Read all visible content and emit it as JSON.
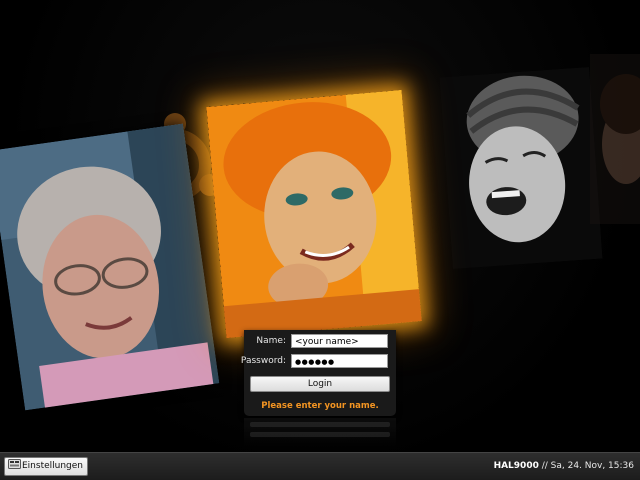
{
  "login": {
    "name_label": "Name:",
    "name_value": "<your name>",
    "password_label": "Password:",
    "password_value": "●●●●●●",
    "login_button": "Login",
    "message": "Please enter your name.",
    "message_color": "#f29422"
  },
  "taskbar": {
    "settings_button": "Einstellungen",
    "hostname": "HAL9000",
    "separator": " // ",
    "datetime": "Sa, 24. Nov, 15:36"
  },
  "colors": {
    "background": "#000000",
    "highlight_glow": "#ffaa1e",
    "panel": "#1a1a1a"
  },
  "icons": {
    "settings": "settings-icon",
    "background_logo": "ubuntu-logo-icon"
  }
}
